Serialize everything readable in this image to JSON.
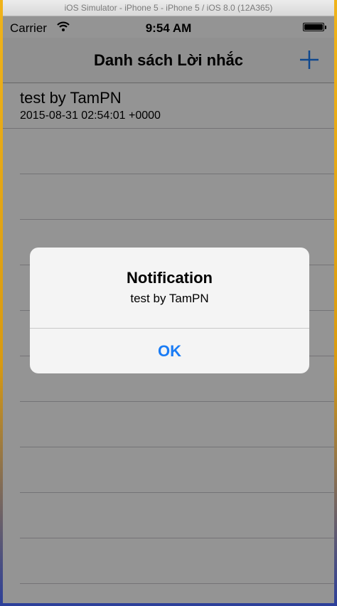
{
  "simulator": {
    "title": "iOS Simulator - iPhone 5 - iPhone 5 / iOS 8.0 (12A365)"
  },
  "status_bar": {
    "carrier": "Carrier",
    "time": "9:54 AM"
  },
  "nav": {
    "title": "Danh sách Lời nhắc",
    "add_icon": "plus-icon"
  },
  "list": {
    "items": [
      {
        "title": "test by TamPN",
        "subtitle": "2015-08-31 02:54:01 +0000"
      }
    ]
  },
  "alert": {
    "title": "Notification",
    "message": "test by TamPN",
    "ok_label": "OK"
  },
  "colors": {
    "accent": "#1a7cf5",
    "overlay": "#8e8e8e"
  }
}
